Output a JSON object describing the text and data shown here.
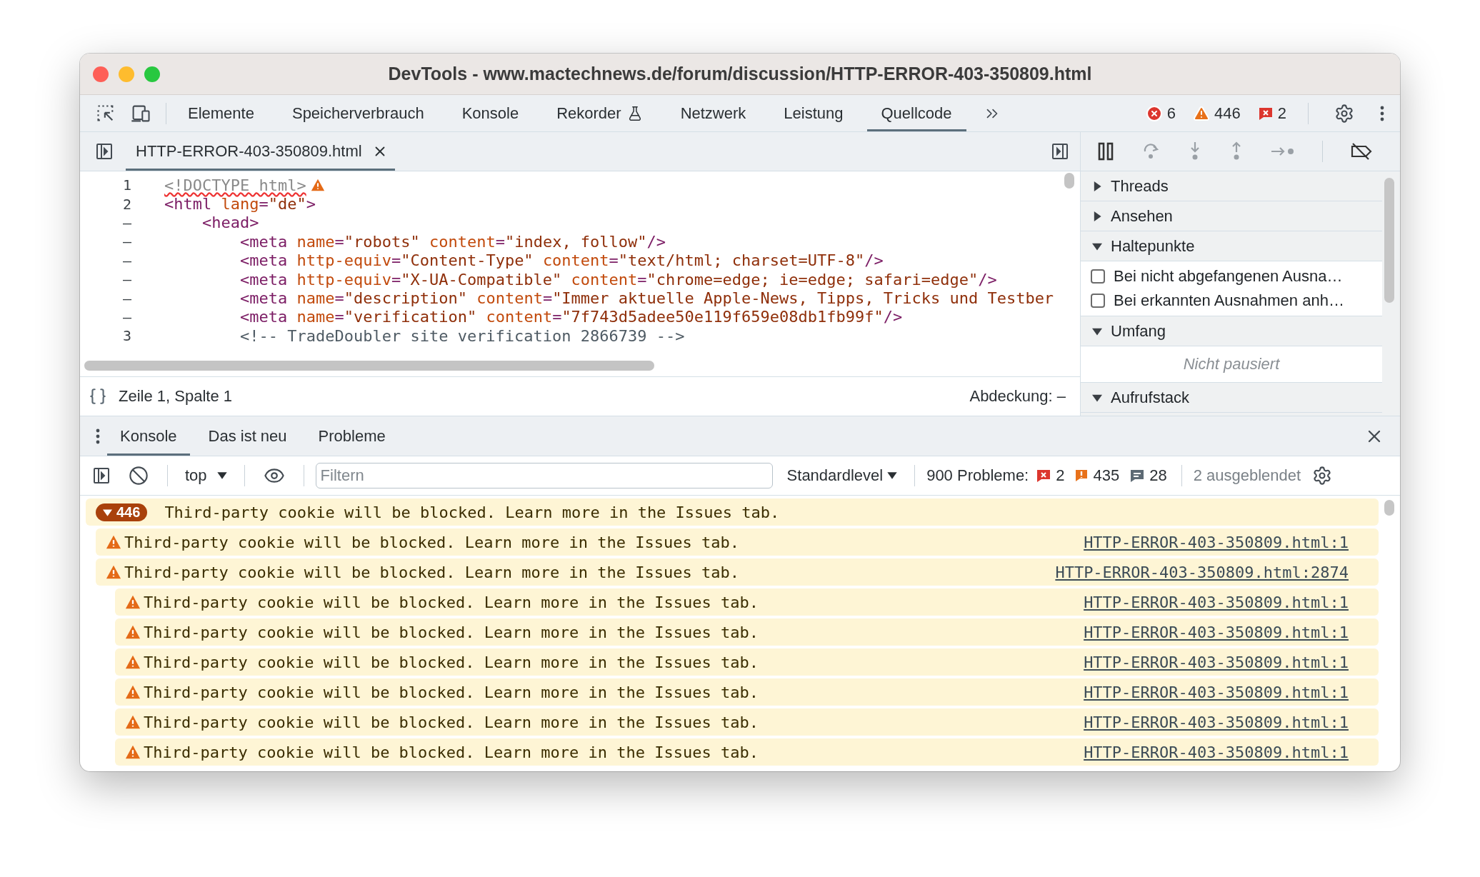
{
  "window": {
    "title": "DevTools - www.mactechnews.de/forum/discussion/HTTP-ERROR-403-350809.html"
  },
  "toolbar": {
    "tabs": [
      {
        "label": "Elemente",
        "selected": false
      },
      {
        "label": "Speicherverbrauch",
        "selected": false
      },
      {
        "label": "Konsole",
        "selected": false
      },
      {
        "label": "Rekorder",
        "selected": false,
        "kind": "flask"
      },
      {
        "label": "Netzwerk",
        "selected": false
      },
      {
        "label": "Leistung",
        "selected": false
      },
      {
        "label": "Quellcode",
        "selected": true
      }
    ],
    "counts": [
      {
        "kind": "error",
        "text": "6"
      },
      {
        "kind": "warning",
        "text": "446"
      },
      {
        "kind": "issue",
        "text": "2"
      }
    ]
  },
  "editor": {
    "file_tab": {
      "label": "HTTP-ERROR-403-350809.html",
      "selected": true
    },
    "lines": [
      {
        "number": "1",
        "warning": true,
        "tokens": [
          {
            "kind": "doctype",
            "text": "<!DOCTYPE html>"
          }
        ]
      },
      {
        "number": "2",
        "warning": false,
        "tokens": [
          {
            "kind": "tag",
            "text": "<html "
          },
          {
            "kind": "attr",
            "text": "lang"
          },
          {
            "kind": "tag",
            "text": "="
          },
          {
            "kind": "value",
            "text": "\"de\""
          },
          {
            "kind": "tag",
            "text": ">"
          }
        ],
        "children": [
          {
            "number": "–",
            "warning": false,
            "tokens": [
              {
                "kind": "tag",
                "text": "<head>"
              }
            ],
            "children": [
              {
                "number": "–",
                "warning": false,
                "tokens": [
                  {
                    "kind": "tag",
                    "text": "<meta "
                  },
                  {
                    "kind": "attr",
                    "text": "name"
                  },
                  {
                    "kind": "tag",
                    "text": "="
                  },
                  {
                    "kind": "value",
                    "text": "\"robots\" "
                  },
                  {
                    "kind": "attr",
                    "text": "content"
                  },
                  {
                    "kind": "tag",
                    "text": "="
                  },
                  {
                    "kind": "value",
                    "text": "\"index, follow\""
                  },
                  {
                    "kind": "tag",
                    "text": "/>"
                  }
                ]
              },
              {
                "number": "–",
                "warning": false,
                "tokens": [
                  {
                    "kind": "tag",
                    "text": "<meta "
                  },
                  {
                    "kind": "attr",
                    "text": "http-equiv"
                  },
                  {
                    "kind": "tag",
                    "text": "="
                  },
                  {
                    "kind": "value",
                    "text": "\"Content-Type\" "
                  },
                  {
                    "kind": "attr",
                    "text": "content"
                  },
                  {
                    "kind": "tag",
                    "text": "="
                  },
                  {
                    "kind": "value",
                    "text": "\"text/html; charset=UTF-8\""
                  },
                  {
                    "kind": "tag",
                    "text": "/>"
                  }
                ]
              },
              {
                "number": "–",
                "warning": false,
                "tokens": [
                  {
                    "kind": "tag",
                    "text": "<meta "
                  },
                  {
                    "kind": "attr",
                    "text": "http-equiv"
                  },
                  {
                    "kind": "tag",
                    "text": "="
                  },
                  {
                    "kind": "value",
                    "text": "\"X-UA-Compatible\" "
                  },
                  {
                    "kind": "attr",
                    "text": "content"
                  },
                  {
                    "kind": "tag",
                    "text": "="
                  },
                  {
                    "kind": "value",
                    "text": "\"chrome=edge; ie=edge; safari=edge\""
                  },
                  {
                    "kind": "tag",
                    "text": "/>"
                  }
                ]
              },
              {
                "number": "–",
                "warning": false,
                "tokens": [
                  {
                    "kind": "tag",
                    "text": "<meta "
                  },
                  {
                    "kind": "attr",
                    "text": "name"
                  },
                  {
                    "kind": "tag",
                    "text": "="
                  },
                  {
                    "kind": "value",
                    "text": "\"description\" "
                  },
                  {
                    "kind": "attr",
                    "text": "content"
                  },
                  {
                    "kind": "tag",
                    "text": "="
                  },
                  {
                    "kind": "value",
                    "text": "\"Immer aktuelle Apple-News, Tipps, Tricks und Testber"
                  }
                ]
              },
              {
                "number": "–",
                "warning": false,
                "tokens": [
                  {
                    "kind": "tag",
                    "text": "<meta "
                  },
                  {
                    "kind": "attr",
                    "text": "name"
                  },
                  {
                    "kind": "tag",
                    "text": "="
                  },
                  {
                    "kind": "value",
                    "text": "\"verification\" "
                  },
                  {
                    "kind": "attr",
                    "text": "content"
                  },
                  {
                    "kind": "tag",
                    "text": "="
                  },
                  {
                    "kind": "value",
                    "text": "\"7f743d5adee50e119f659e08db1fb99f\""
                  },
                  {
                    "kind": "tag",
                    "text": "/>"
                  }
                ]
              },
              {
                "number": "3",
                "warning": false,
                "tokens": [
                  {
                    "kind": "comment",
                    "text": "<!-- TradeDoubler site verification 2866739 -->"
                  }
                ]
              }
            ]
          }
        ]
      }
    ],
    "status": {
      "position": "Zeile 1, Spalte 1",
      "coverage": "Abdeckung: –"
    }
  },
  "debugger": {
    "sections": [
      {
        "title": "Threads",
        "expanded": false
      },
      {
        "title": "Ansehen",
        "expanded": false
      },
      {
        "title": "Haltepunkte",
        "expanded": true,
        "checkboxes": [
          {
            "label": "Bei nicht abgefangenen Ausna…",
            "checked": false
          },
          {
            "label": "Bei erkannten Ausnahmen anh…",
            "checked": false
          }
        ]
      },
      {
        "title": "Umfang",
        "expanded": true,
        "message": "Nicht pausiert"
      },
      {
        "title": "Aufrufstack",
        "expanded": true
      }
    ]
  },
  "drawer": {
    "tabs": [
      {
        "label": "Konsole",
        "selected": true
      },
      {
        "label": "Das ist neu",
        "selected": false
      },
      {
        "label": "Probleme",
        "selected": false
      }
    ],
    "context": "top",
    "filter_placeholder": "Filtern",
    "level": "Standardlevel",
    "issues_label": "900 Probleme:",
    "issue_counts": [
      {
        "kind": "error",
        "text": "2"
      },
      {
        "kind": "warning",
        "text": "435"
      },
      {
        "kind": "info",
        "text": "28"
      }
    ],
    "hidden": "2 ausgeblendet"
  },
  "console": {
    "group": {
      "count": "446",
      "expanded": true,
      "message": "Third-party cookie will be blocked. Learn more in the Issues tab."
    },
    "messages": [
      {
        "text": "Third-party cookie will be blocked. Learn more in the Issues tab.",
        "source": "HTTP-ERROR-403-350809.html:1"
      },
      {
        "text": "Third-party cookie will be blocked. Learn more in the Issues tab.",
        "source": "HTTP-ERROR-403-350809.html:2874",
        "children": [
          {
            "text": "Third-party cookie will be blocked. Learn more in the Issues tab.",
            "source": "HTTP-ERROR-403-350809.html:1"
          },
          {
            "text": "Third-party cookie will be blocked. Learn more in the Issues tab.",
            "source": "HTTP-ERROR-403-350809.html:1"
          },
          {
            "text": "Third-party cookie will be blocked. Learn more in the Issues tab.",
            "source": "HTTP-ERROR-403-350809.html:1"
          },
          {
            "text": "Third-party cookie will be blocked. Learn more in the Issues tab.",
            "source": "HTTP-ERROR-403-350809.html:1"
          },
          {
            "text": "Third-party cookie will be blocked. Learn more in the Issues tab.",
            "source": "HTTP-ERROR-403-350809.html:1"
          },
          {
            "text": "Third-party cookie will be blocked. Learn more in the Issues tab.",
            "source": "HTTP-ERROR-403-350809.html:1"
          }
        ]
      }
    ]
  }
}
